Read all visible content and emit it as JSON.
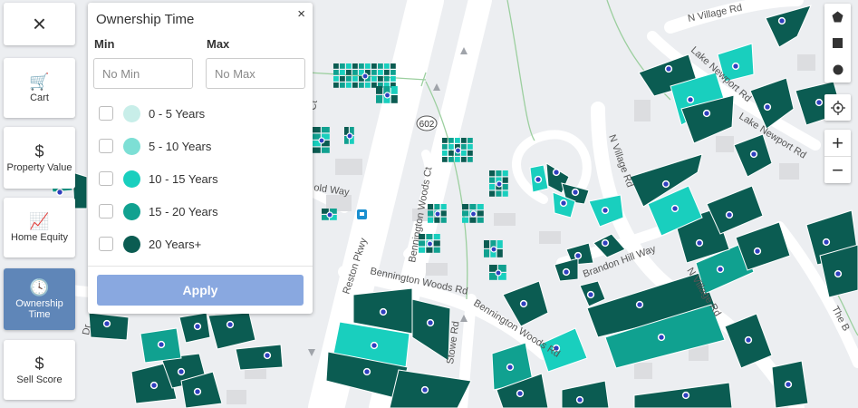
{
  "sidebar": {
    "close_label": "×",
    "items": [
      {
        "name": "cart",
        "label": "Cart",
        "icon": "cart-icon",
        "glyph": "🛒"
      },
      {
        "name": "property-value",
        "label": "Property Value",
        "icon": "dollar-icon",
        "glyph": "$"
      },
      {
        "name": "home-equity",
        "label": "Home Equity",
        "icon": "chart-icon",
        "glyph": "📈"
      },
      {
        "name": "ownership-time",
        "label": "Ownership Time",
        "icon": "clock-icon",
        "glyph": "🕓",
        "active": true
      },
      {
        "name": "sell-score",
        "label": "Sell Score",
        "icon": "sell-score-icon",
        "glyph": "$"
      }
    ]
  },
  "panel": {
    "title": "Ownership Time",
    "close_label": "×",
    "min_label": "Min",
    "max_label": "Max",
    "min_placeholder": "No Min",
    "max_placeholder": "No Max",
    "options": [
      {
        "label": "0 - 5 Years",
        "color": "#c8eee9"
      },
      {
        "label": "5 - 10 Years",
        "color": "#7ddfd5"
      },
      {
        "label": "10 - 15 Years",
        "color": "#19cfbe"
      },
      {
        "label": "15 - 20 Years",
        "color": "#10a190"
      },
      {
        "label": "20 Years+",
        "color": "#0b5c52"
      }
    ],
    "apply_label": "Apply"
  },
  "map": {
    "roads": {
      "reston_pkwy": "Reston Pkwy",
      "route_badge": "602",
      "bennington_woods_rd_1": "Bennington Woods Rd",
      "bennington_woods_rd_2": "Bennington Woods Rd",
      "bennington_woods_ct": "Bennington Woods Ct",
      "stowe_rd": "Stowe Rd",
      "brandon_hill_way": "Brandon Hill Way",
      "n_village_rd_1": "N Village Rd",
      "n_village_rd_2": "N Village Rd",
      "n_village_rd_3": "N Village Rd",
      "lake_newport_rd_1": "Lake Newport Rd",
      "lake_newport_rd_2": "Lake Newport Rd",
      "the_b": "The B",
      "old_way": "old Way",
      "ct": "Ct",
      "dr": "Dr"
    }
  },
  "controls": {
    "draw_polygon_icon": "pentagon-icon",
    "draw_rectangle_icon": "square-icon",
    "draw_circle_icon": "circle-icon",
    "locate_icon": "locate-icon",
    "zoom_in": "+",
    "zoom_out": "−"
  },
  "colors": {
    "dark": "#0b5c52",
    "mid": "#10a190",
    "bright": "#19cfbe",
    "light": "#7ddfd5",
    "accent_active": "#5f86b8",
    "apply": "#89a8e0"
  }
}
